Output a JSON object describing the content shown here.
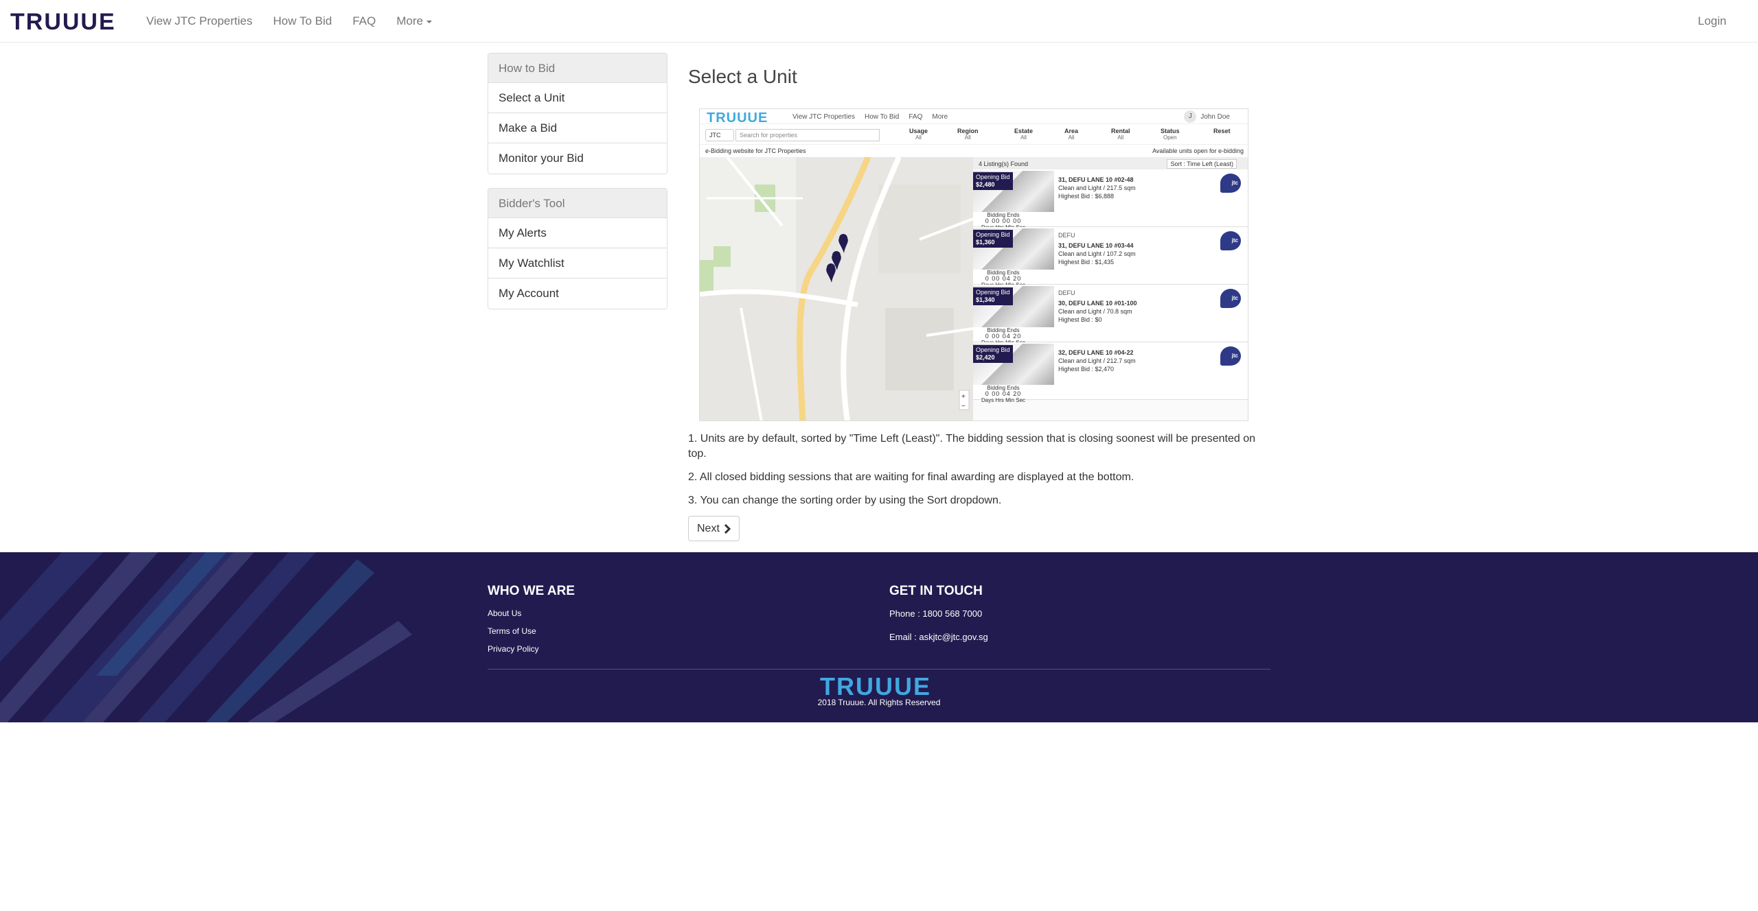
{
  "brand": {
    "name": "TRUUUE",
    "color": "#221b4f",
    "accent": "#3fa9e0"
  },
  "nav": {
    "links": [
      "View JTC Properties",
      "How To Bid",
      "FAQ",
      "More"
    ],
    "login": "Login"
  },
  "sidebar": {
    "groups": [
      {
        "title": "How to Bid",
        "items": [
          "Select a Unit",
          "Make a Bid",
          "Monitor your Bid"
        ]
      },
      {
        "title": "Bidder's Tool",
        "items": [
          "My Alerts",
          "My Watchlist",
          "My Account"
        ]
      }
    ]
  },
  "main": {
    "title": "Select a Unit",
    "steps": [
      "1. Units are by default, sorted by \"Time Left (Least)\". The bidding session that is closing soonest will be presented on top.",
      "2. All closed bidding sessions that are waiting for final awarding are displayed at the bottom.",
      "3. You can change the sorting order by using the Sort dropdown."
    ],
    "next_label": "Next"
  },
  "screenshot": {
    "nav_links": [
      "View JTC Properties",
      "How To Bid",
      "FAQ",
      "More"
    ],
    "user_initial": "J",
    "user_name": "John Doe",
    "jtc_select": "JTC",
    "search_placeholder": "Search for properties",
    "filters": [
      {
        "label": "Usage",
        "value": "All"
      },
      {
        "label": "Region",
        "value": "All"
      },
      {
        "label": "Estate",
        "value": "All"
      },
      {
        "label": "Area",
        "value": "All"
      },
      {
        "label": "Rental",
        "value": "All"
      },
      {
        "label": "Status",
        "value": "Open"
      },
      {
        "label": "Reset",
        "value": ""
      }
    ],
    "info_left": "e-Bidding website for JTC Properties",
    "info_right": "Available units open for e-bidding",
    "listings_found": "4 Listing(s) Found",
    "sort": "Sort : Time Left (Least)",
    "timer_caption": "Bidding Ends",
    "timer_units": "Days Hrs Min Sec",
    "listings": [
      {
        "tag": "Opening Bid",
        "price": "$2,480",
        "estate": "",
        "address": "31, DEFU LANE 10 #02-48",
        "spec": "Clean and Light / 217.5 sqm",
        "highest": "Highest Bid : $6,888",
        "timer": "0 00 00 00"
      },
      {
        "tag": "Opening Bid",
        "price": "$1,360",
        "estate": "DEFU",
        "address": "31, DEFU LANE 10 #03-44",
        "spec": "Clean and Light / 107.2 sqm",
        "highest": "Highest Bid : $1,435",
        "timer": "0 00 04 20"
      },
      {
        "tag": "Opening Bid",
        "price": "$1,340",
        "estate": "DEFU",
        "address": "30, DEFU LANE 10 #01-100",
        "spec": "Clean and Light / 70.8 sqm",
        "highest": "Highest Bid : $0",
        "timer": "0 00 04 20"
      },
      {
        "tag": "Opening Bid",
        "price": "$2,420",
        "estate": "",
        "address": "32, DEFU LANE 10 #04-22",
        "spec": "Clean and Light / 212.7 sqm",
        "highest": "Highest Bid : $2,470",
        "timer": "0 00 04 20"
      }
    ],
    "jtc_icon": "jtc"
  },
  "footer": {
    "who_title": "WHO WE ARE",
    "who_links": [
      "About Us",
      "Terms of Use",
      "Privacy Policy"
    ],
    "contact_title": "GET IN TOUCH",
    "phone": "Phone : 1800 568 7000",
    "email": "Email : askjtc@jtc.gov.sg",
    "logo": "TRUUUE",
    "copyright": "2018 Truuue. All Rights Reserved",
    "bg": "#221b4f"
  }
}
